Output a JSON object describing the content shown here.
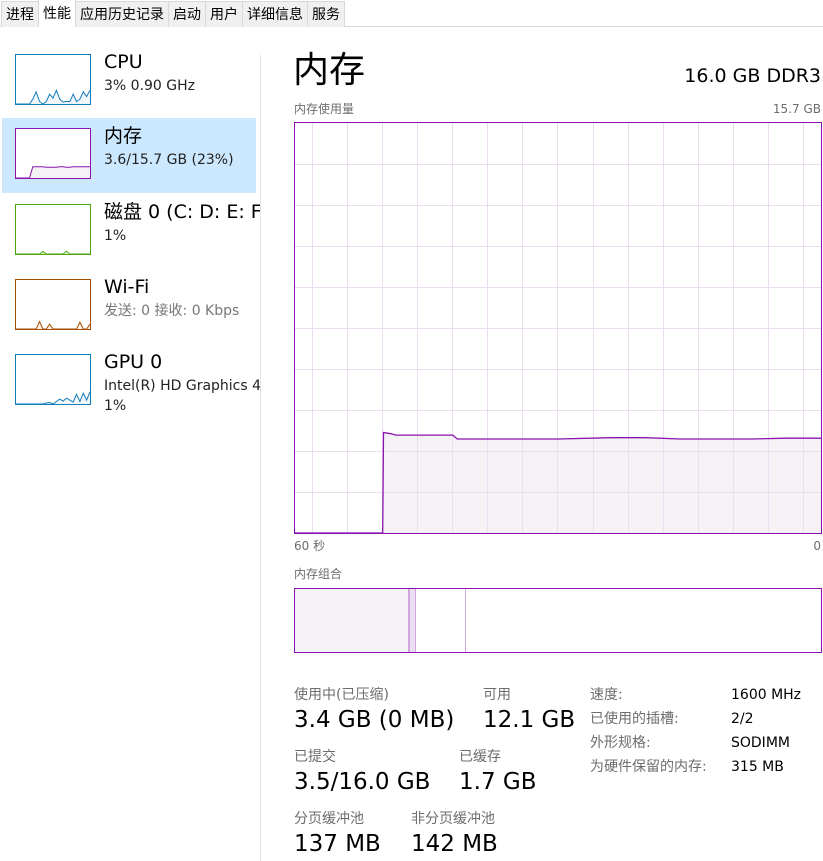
{
  "tabs": [
    {
      "label": "进程",
      "active": false
    },
    {
      "label": "性能",
      "active": true
    },
    {
      "label": "应用历史记录",
      "active": false
    },
    {
      "label": "启动",
      "active": false
    },
    {
      "label": "用户",
      "active": false
    },
    {
      "label": "详细信息",
      "active": false
    },
    {
      "label": "服务",
      "active": false
    }
  ],
  "sidebar": {
    "items": [
      {
        "title": "CPU",
        "subtitle": "3% 0.90 GHz",
        "color": "#117dbb",
        "fill": "#f1f6fa",
        "selected": false,
        "spark": [
          0,
          0,
          0,
          0,
          0,
          0.1,
          0.25,
          0.05,
          0,
          0.05,
          0.2,
          0.12,
          0.28,
          0.1,
          0.04,
          0.05,
          0.05,
          0.2,
          0.05,
          0.1,
          0.25,
          0.15,
          0.28
        ]
      },
      {
        "title": "内存",
        "subtitle": "3.6/15.7 GB (23%)",
        "color": "#8b12ae",
        "fill": "#f4f2f4",
        "selected": true,
        "spark": [
          0,
          0,
          0,
          0,
          0,
          0.23,
          0.23,
          0.23,
          0.23,
          0.22,
          0.22,
          0.22,
          0.22,
          0.23,
          0.23,
          0.22,
          0.22,
          0.23,
          0.23,
          0.23,
          0.23,
          0.23,
          0.23
        ]
      },
      {
        "title": "磁盘 0 (C: D: E: F:",
        "subtitle": "1%",
        "color": "#4da60c",
        "fill": "#effaeb",
        "selected": false,
        "spark": [
          0,
          0,
          0,
          0,
          0,
          0,
          0,
          0,
          0.05,
          0,
          0,
          0,
          0,
          0,
          0,
          0.06,
          0,
          0,
          0,
          0,
          0,
          0,
          0
        ]
      },
      {
        "title": "Wi-Fi",
        "subtitle": "发送: 0 接收: 0 Kbps",
        "subtitle_gray": true,
        "color": "#a74f01",
        "fill": "#fcf3eb",
        "selected": false,
        "spark": [
          0,
          0,
          0,
          0,
          0,
          0,
          0,
          0.15,
          0,
          0,
          0.1,
          0,
          0,
          0,
          0,
          0,
          0,
          0,
          0,
          0.14,
          0,
          0,
          0.1
        ]
      },
      {
        "title": "GPU 0",
        "subtitle": "Intel(R) HD Graphics 4",
        "subtitle2": "1%",
        "color": "#117dbb",
        "fill": "#f1f6fa",
        "selected": false,
        "spark": [
          0,
          0,
          0,
          0,
          0,
          0,
          0,
          0,
          0,
          0.02,
          0.03,
          0,
          0.05,
          0.1,
          0.06,
          0.12,
          0.08,
          0.04,
          0.2,
          0.05,
          0.22,
          0.08,
          0.25
        ]
      }
    ]
  },
  "main": {
    "title": "内存",
    "spec": "16.0 GB DDR3",
    "usage_label": "内存使用量",
    "usage_max": "15.7 GB",
    "time_left_label": "60 秒",
    "time_right_label": "0",
    "composition_label": "内存组合",
    "colors": {
      "line": "#8b12ae",
      "fill": "#f4f2f4",
      "grid": "#ecdcf0"
    }
  },
  "chart_data": {
    "type": "area",
    "title": "内存使用量",
    "xlabel": "",
    "ylabel": "",
    "x_unit": "seconds ago",
    "xlim": [
      60,
      0
    ],
    "ylim": [
      0,
      15.7
    ],
    "y_unit": "GB",
    "grid": true,
    "x": [
      60,
      50,
      49.9,
      49,
      48.5,
      44,
      42,
      41.5,
      30,
      24,
      20,
      16,
      14,
      8,
      4,
      0
    ],
    "values": [
      0,
      0,
      3.85,
      3.8,
      3.75,
      3.75,
      3.75,
      3.6,
      3.6,
      3.65,
      3.65,
      3.6,
      3.6,
      3.6,
      3.63,
      3.63
    ]
  },
  "composition": {
    "segments": [
      {
        "name": "in-use",
        "fraction": 0.217,
        "color": "#f4f2f4"
      },
      {
        "name": "modified",
        "fraction": 0.013,
        "color": "#e9dff0"
      },
      {
        "name": "standby",
        "fraction": 0.095,
        "color": "#ffffff"
      },
      {
        "name": "free",
        "fraction": 0.675,
        "color": "#ffffff"
      }
    ],
    "divider_color": "#d4a6e0"
  },
  "stats": {
    "in_use_label": "使用中(已压缩)",
    "in_use_value": "3.4 GB (0 MB)",
    "available_label": "可用",
    "available_value": "12.1 GB",
    "committed_label": "已提交",
    "committed_value": "3.5/16.0 GB",
    "cached_label": "已缓存",
    "cached_value": "1.7 GB",
    "paged_pool_label": "分页缓冲池",
    "paged_pool_value": "137 MB",
    "nonpaged_pool_label": "非分页缓冲池",
    "nonpaged_pool_value": "142 MB"
  },
  "properties": [
    {
      "label": "速度:",
      "value": "1600 MHz"
    },
    {
      "label": "已使用的插槽:",
      "value": "2/2"
    },
    {
      "label": "外形规格:",
      "value": "SODIMM"
    },
    {
      "label": "为硬件保留的内存:",
      "value": "315 MB"
    }
  ]
}
